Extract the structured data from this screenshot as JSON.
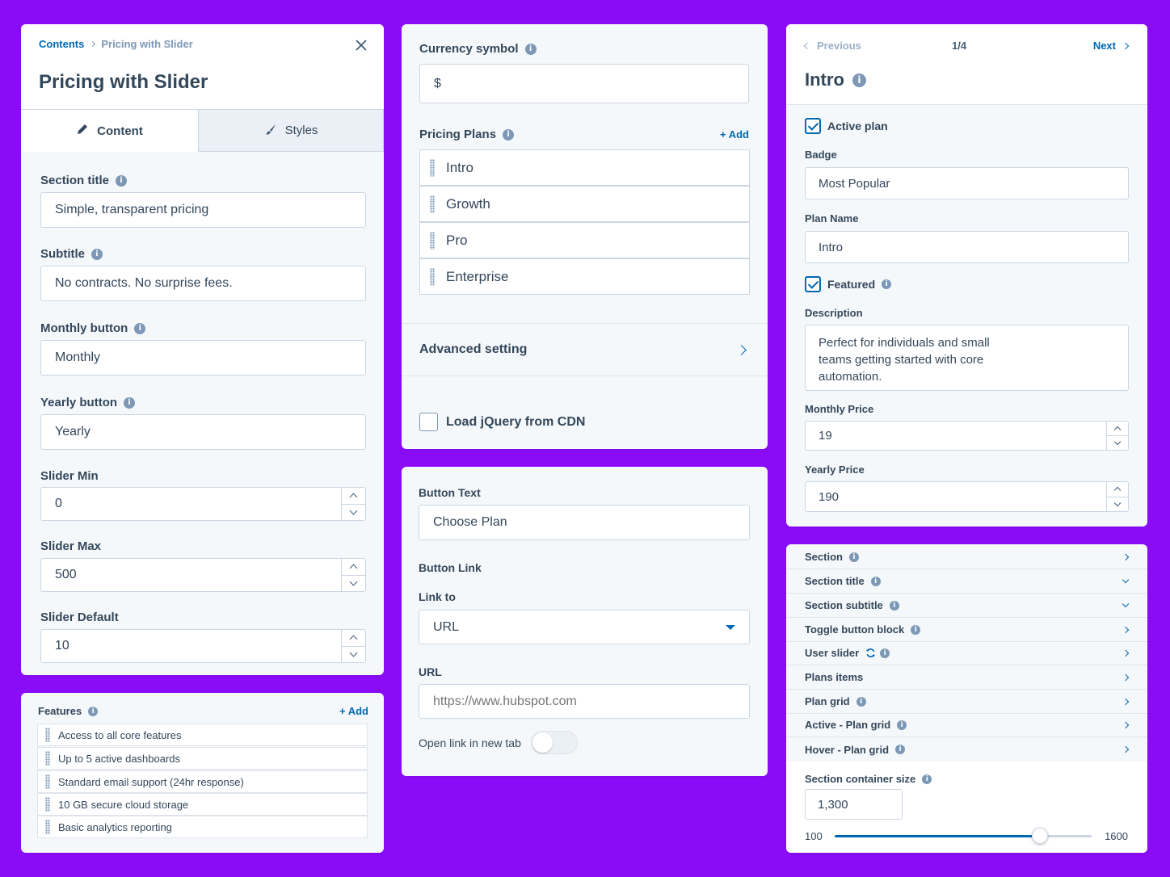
{
  "left_panel": {
    "breadcrumb_root": "Contents",
    "breadcrumb_current": "Pricing with Slider",
    "title": "Pricing with Slider",
    "tab_content": "Content",
    "tab_styles": "Styles",
    "section_title_label": "Section title",
    "section_title_value": "Simple, transparent pricing",
    "subtitle_label": "Subtitle",
    "subtitle_value": "No contracts. No surprise fees.",
    "monthly_button_label": "Monthly button",
    "monthly_button_value": "Monthly",
    "yearly_button_label": "Yearly button",
    "yearly_button_value": "Yearly",
    "slider_min_label": "Slider Min",
    "slider_min_value": "0",
    "slider_max_label": "Slider Max",
    "slider_max_value": "500",
    "slider_default_label": "Slider Default",
    "slider_default_value": "10"
  },
  "features_panel": {
    "label": "Features",
    "add": "+ Add",
    "items": [
      "Access to all core features",
      "Up to 5 active dashboards",
      "Standard email support (24hr response)",
      "10 GB secure cloud storage",
      "Basic analytics reporting"
    ]
  },
  "middle_top": {
    "currency_label": "Currency symbol",
    "currency_value": "$",
    "plans_label": "Pricing Plans",
    "plans_add": "+ Add",
    "plans": [
      "Intro",
      "Growth",
      "Pro",
      "Enterprise"
    ],
    "advanced": "Advanced setting",
    "jquery_label": "Load jQuery from CDN"
  },
  "middle_bottom": {
    "button_text_label": "Button Text",
    "button_text_value": "Choose Plan",
    "button_link_label": "Button Link",
    "link_to_label": "Link to",
    "link_to_value": "URL",
    "url_label": "URL",
    "url_placeholder": "https://www.hubspot.com",
    "new_tab_label": "Open link in new tab"
  },
  "right_top": {
    "previous": "Previous",
    "pager": "1/4",
    "next": "Next",
    "title": "Intro",
    "active_plan_label": "Active plan",
    "badge_label": "Badge",
    "badge_value": "Most Popular",
    "plan_name_label": "Plan Name",
    "plan_name_value": "Intro",
    "featured_label": "Featured",
    "description_label": "Description",
    "description_value": "Perfect for individuals and small teams getting started with core automation.",
    "monthly_price_label": "Monthly Price",
    "monthly_price_value": "19",
    "yearly_price_label": "Yearly Price",
    "yearly_price_value": "190"
  },
  "right_bottom": {
    "rows": [
      {
        "label": "Section",
        "chevron": "right"
      },
      {
        "label": "Section title",
        "chevron": "down"
      },
      {
        "label": "Section subtitle",
        "chevron": "down"
      },
      {
        "label": "Toggle button block",
        "chevron": "right"
      },
      {
        "label": "User slider",
        "chevron": "right"
      },
      {
        "label": "Plans items",
        "chevron": "right"
      },
      {
        "label": "Plan grid",
        "chevron": "right"
      },
      {
        "label": "Active - Plan grid",
        "chevron": "right"
      },
      {
        "label": "Hover - Plan grid",
        "chevron": "right"
      }
    ],
    "container_size_label": "Section container size",
    "container_size_value": "1,300",
    "slider_min": "100",
    "slider_max": "1600",
    "slider_fraction": 0.8
  },
  "colors": {
    "background": "#8a0cf7",
    "accent": "#0068b1",
    "text": "#33475b"
  }
}
